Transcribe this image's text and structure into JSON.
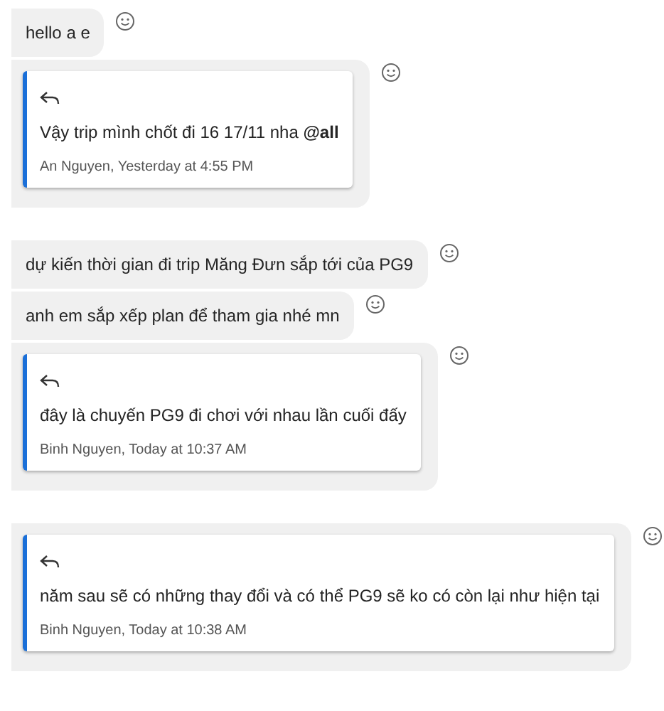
{
  "groups": [
    {
      "messages": [
        {
          "kind": "text",
          "text": "hello a e"
        },
        {
          "kind": "quote",
          "text": "Vậy trip mình chốt đi 16 17/11 nha **@all**",
          "author": "An Nguyen, Yesterday at 4:55 PM"
        }
      ]
    },
    {
      "messages": [
        {
          "kind": "text",
          "text": "dự kiến thời gian đi trip Măng Đưn sắp tới của PG9"
        },
        {
          "kind": "text",
          "text": "anh em sắp xếp plan để tham gia nhé mn"
        },
        {
          "kind": "quote",
          "text": "đây là chuyến PG9 đi chơi với nhau lần cuối đấy",
          "author": "Binh Nguyen, Today at 10:37 AM"
        }
      ]
    },
    {
      "messages": [
        {
          "kind": "quote",
          "text": "năm sau sẽ có những thay đổi và có thể PG9 sẽ ko có còn lại như hiện tại",
          "author": "Binh Nguyen, Today at 10:38 AM"
        }
      ]
    }
  ]
}
